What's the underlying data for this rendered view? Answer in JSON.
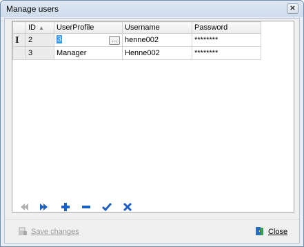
{
  "window": {
    "title": "Manage users"
  },
  "grid": {
    "columns": [
      {
        "label": "ID",
        "sort": "▲"
      },
      {
        "label": "UserProfile"
      },
      {
        "label": "Username"
      },
      {
        "label": "Password"
      }
    ],
    "rows": [
      {
        "cursor": "I",
        "id": "2",
        "profile": "3",
        "ellipsis": "...",
        "username": "henne002",
        "password": "********"
      },
      {
        "cursor": "",
        "id": "3",
        "profile": "Manager",
        "username": "Henne002",
        "password": "********"
      }
    ]
  },
  "navigator": {
    "buttons": [
      {
        "name": "prior",
        "enabled": false
      },
      {
        "name": "next",
        "enabled": true
      },
      {
        "name": "insert",
        "enabled": true
      },
      {
        "name": "delete",
        "enabled": true
      },
      {
        "name": "post",
        "enabled": true
      },
      {
        "name": "cancel",
        "enabled": true
      }
    ]
  },
  "footer": {
    "save_label": "Save changes",
    "close_label": "Close"
  },
  "colors": {
    "accent_blue": "#1b5fc4",
    "disabled_gray": "#b0b0b0"
  }
}
